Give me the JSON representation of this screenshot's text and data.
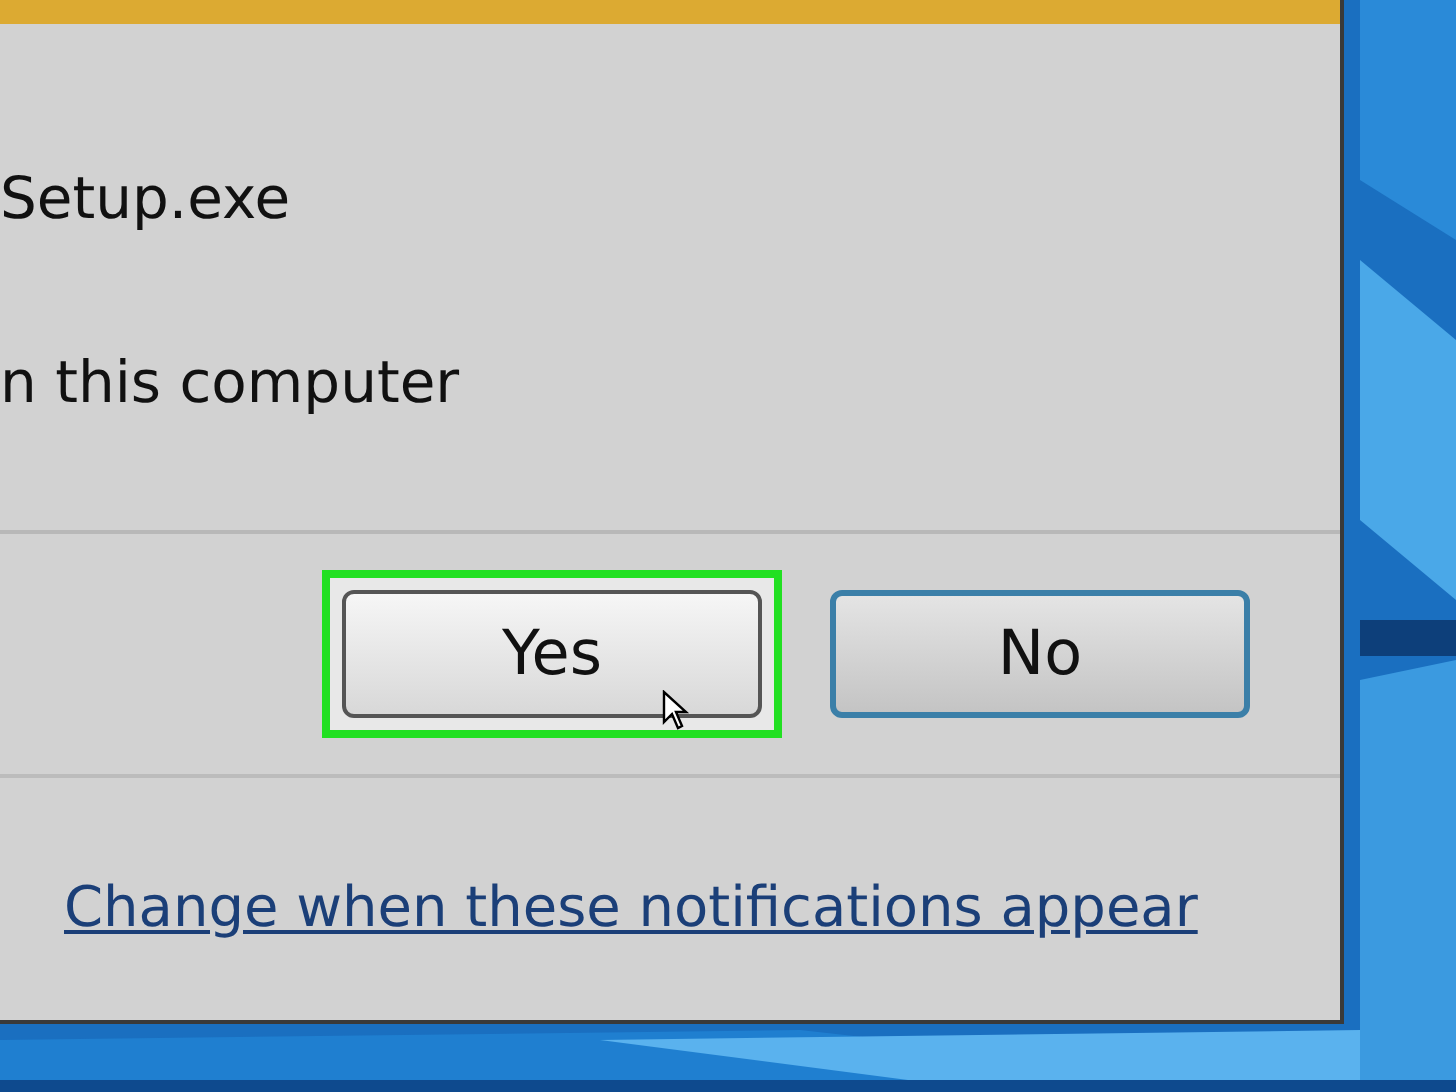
{
  "dialog": {
    "lines": [
      "Setup.exe",
      "n this computer"
    ],
    "buttons": [
      {
        "label": "Yes",
        "highlighted": true,
        "default": false
      },
      {
        "label": "No",
        "highlighted": false,
        "default": true
      }
    ],
    "link": "Change when these notifications appear"
  }
}
